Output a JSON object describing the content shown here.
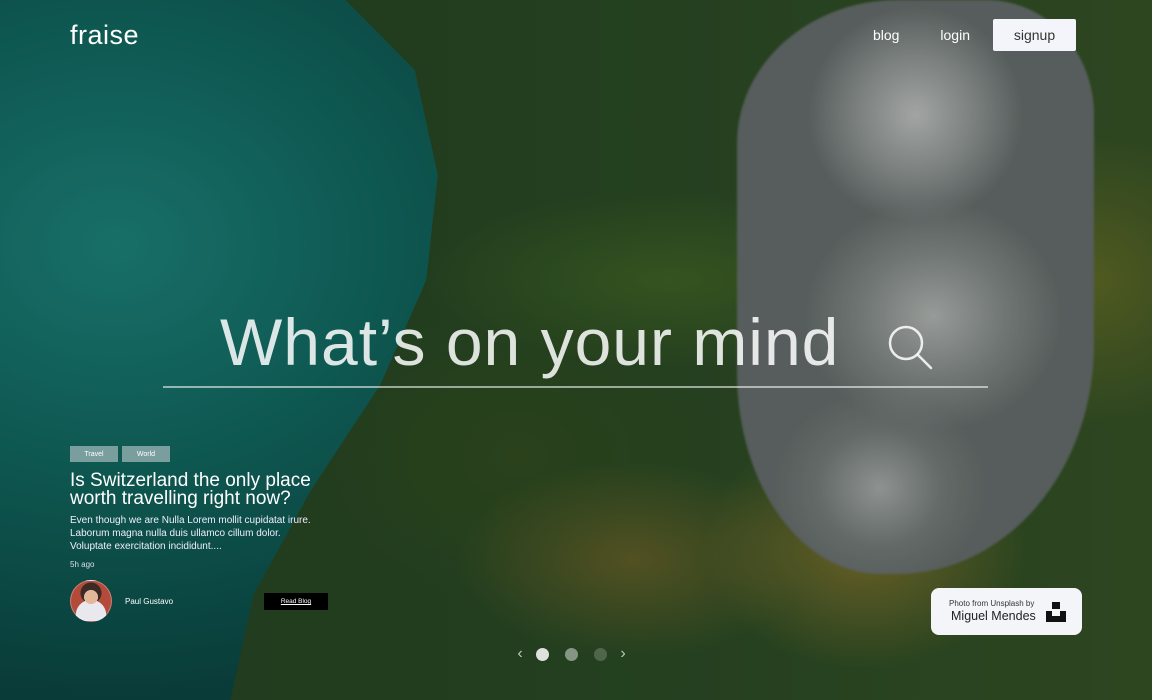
{
  "brand": {
    "logo": "fraise"
  },
  "nav": {
    "blog": "blog",
    "login": "login",
    "signup": "signup"
  },
  "search": {
    "placeholder": "What’s on your mind"
  },
  "featured_post": {
    "tags": [
      "Travel",
      "World"
    ],
    "title": "Is Switzerland the only place worth travelling right now?",
    "excerpt": "Even though we are Nulla Lorem mollit cupidatat irure. Laborum magna nulla duis ullamco cillum dolor. Voluptate exercitation incididunt....",
    "time": "5h ago",
    "author": "Paul Gustavo",
    "read_button": "Read Blog"
  },
  "carousel": {
    "prev_icon": "chevron-left-icon",
    "next_icon": "chevron-right-icon",
    "slides": 3,
    "active": 1
  },
  "photo_credit": {
    "line1": "Photo from Unsplash by",
    "photographer": "Miguel Mendes",
    "icon": "unsplash-icon"
  }
}
